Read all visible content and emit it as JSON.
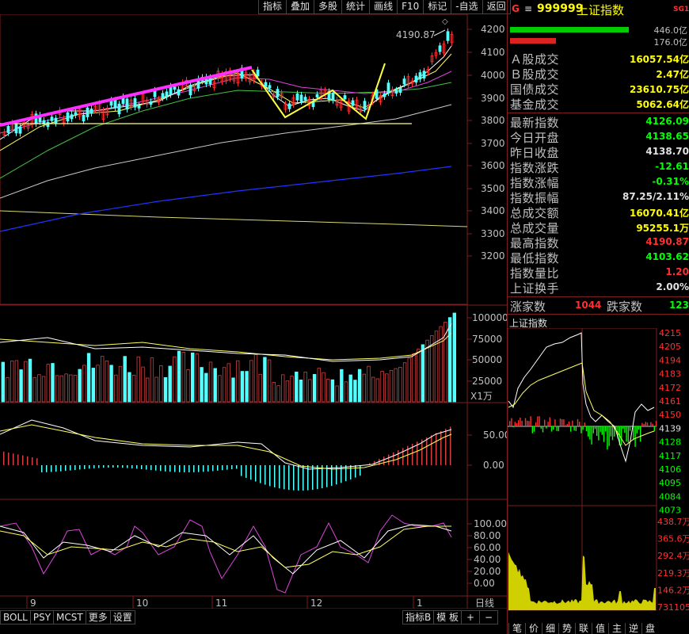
{
  "toolbar": {
    "buttons": [
      "指标",
      "叠加",
      "多股",
      "统计",
      "画线",
      "F10",
      "标记",
      "-自选",
      "返回"
    ]
  },
  "header": {
    "g_label": "G",
    "menu_label": "≡",
    "code": "999999",
    "name": "上证指数",
    "tag": "SG1"
  },
  "volume_bars": {
    "top_value": "446.0亿",
    "bottom_value": "176.0亿",
    "green_fraction": 0.9,
    "red_fraction": 0.4
  },
  "quote_rows": [
    {
      "key": "Ａ股成交",
      "value": "16057.54亿",
      "color": "#ffff00"
    },
    {
      "key": "Ｂ股成交",
      "value": "2.47亿",
      "color": "#ffff00"
    },
    {
      "key": "国债成交",
      "value": "23610.75亿",
      "color": "#ffff00"
    },
    {
      "key": "基金成交",
      "value": "5062.64亿",
      "color": "#ffff00"
    }
  ],
  "index_rows": [
    {
      "key": "最新指数",
      "value": "4126.09",
      "color": "#00ff00"
    },
    {
      "key": "今日开盘",
      "value": "4138.65",
      "color": "#00ff00"
    },
    {
      "key": "昨日收盘",
      "value": "4138.70",
      "color": "#e0e0e0"
    },
    {
      "key": "指数涨跌",
      "value": "-12.61",
      "color": "#00ff00"
    },
    {
      "key": "指数涨幅",
      "value": "-0.31%",
      "color": "#00ff00"
    },
    {
      "key": "指数振幅",
      "value": "87.25/2.11%",
      "color": "#e0e0e0"
    },
    {
      "key": "总成交额",
      "value": "16070.41亿",
      "color": "#ffff00"
    },
    {
      "key": "总成交量",
      "value": "95255.1万",
      "color": "#ffff00"
    },
    {
      "key": "最高指数",
      "value": "4190.87",
      "color": "#ff3030"
    },
    {
      "key": "最低指数",
      "value": "4103.62",
      "color": "#00ff00"
    },
    {
      "key": "指数量比",
      "value": "1.20",
      "color": "#ff3030"
    },
    {
      "key": "上证换手",
      "value": "2.00%",
      "color": "#e0e0e0"
    }
  ],
  "breadth": {
    "up_label": "涨家数",
    "up_value": "1044",
    "down_label": "跌家数",
    "down_value": "123"
  },
  "intraday": {
    "title": "上证指数",
    "price_ticks": [
      "4215",
      "4205",
      "4194",
      "4183",
      "4172",
      "4161",
      "4150",
      "4139",
      "4128",
      "4117",
      "4106",
      "4095",
      "4084",
      "4073"
    ],
    "vol_ticks": [
      "438.7万",
      "365.6万",
      "292.4万",
      "219.3万",
      "146.2万",
      "731105"
    ]
  },
  "main_chart": {
    "high_label": "4190.87",
    "price_ticks": [
      "4200",
      "4100",
      "4000",
      "3900",
      "3800",
      "3700",
      "3600",
      "3500",
      "3400",
      "3300",
      "3200"
    ],
    "vol_ticks": [
      "100000",
      "75000",
      "50000",
      "25000"
    ],
    "vol_unit": "X1万",
    "macd_ticks": [
      "50.00",
      "0.00"
    ],
    "kdj_ticks": [
      "100.00",
      "80.00",
      "60.00",
      "40.00",
      "20.00",
      "0.00"
    ],
    "months": [
      "9",
      "10",
      "11",
      "12",
      "1"
    ],
    "period": "日线"
  },
  "bottom_tabs": [
    "BOLL",
    "PSY",
    "MCST",
    "更多",
    "设置"
  ],
  "bottom_right": [
    "指标B",
    "模 板",
    "+",
    "−"
  ],
  "right_tabs": [
    "笔",
    "价",
    "细",
    "势",
    "联",
    "值",
    "主",
    "逆",
    "盘"
  ]
}
